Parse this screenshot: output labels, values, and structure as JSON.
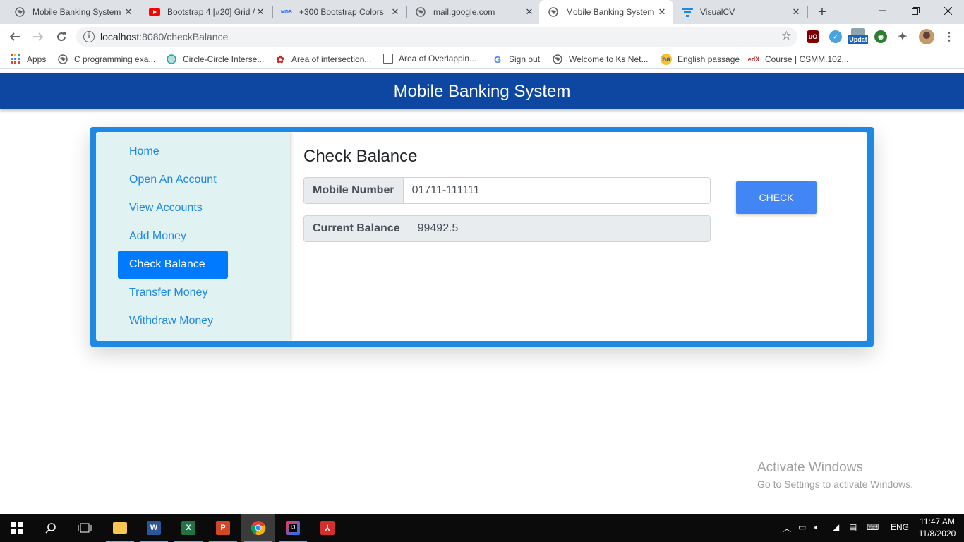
{
  "browser": {
    "tabs": [
      {
        "title": "Mobile Banking System",
        "icon": "globe-icon"
      },
      {
        "title": "Bootstrap 4 [#20] Grid /",
        "icon": "youtube-icon"
      },
      {
        "title": "+300 Bootstrap Colors",
        "icon": "mdb-icon",
        "icon_text": "MDB"
      },
      {
        "title": "mail.google.com",
        "icon": "globe-icon"
      },
      {
        "title": "Mobile Banking System",
        "icon": "globe-icon"
      },
      {
        "title": "VisualCV",
        "icon": "visualcv-icon"
      }
    ],
    "new_tab_symbol": "+",
    "url_host": "localhost",
    "url_path": ":8080/checkBalance",
    "extension_badge": "Updat",
    "bookmarks": [
      {
        "label": "Apps",
        "icon": "apps-grid-icon"
      },
      {
        "label": "C programming exa...",
        "icon": "globe-icon"
      },
      {
        "label": "Circle-Circle Interse...",
        "icon": "globe-icon"
      },
      {
        "label": "Area of intersection...",
        "icon": "gear-icon"
      },
      {
        "label": "Area of Overlappin...",
        "icon": "document-icon"
      },
      {
        "label": "Sign out",
        "icon": "google-icon",
        "icon_text": "G"
      },
      {
        "label": "Welcome to Ks Net...",
        "icon": "globe-icon"
      },
      {
        "label": "English passage",
        "icon": "ba-icon",
        "icon_text": "ba"
      },
      {
        "label": "Course | CSMM.102...",
        "icon": "edx-icon",
        "icon_text": "edX"
      }
    ]
  },
  "app": {
    "title": "Mobile Banking System",
    "nav": [
      {
        "label": "Home",
        "active": false
      },
      {
        "label": "Open An Account",
        "active": false
      },
      {
        "label": "View Accounts",
        "active": false
      },
      {
        "label": "Add Money",
        "active": false
      },
      {
        "label": "Check Balance",
        "active": true
      },
      {
        "label": "Transfer Money",
        "active": false
      },
      {
        "label": "Withdraw Money",
        "active": false
      }
    ],
    "heading": "Check Balance",
    "mobile_label": "Mobile Number",
    "mobile_value": "01711-111111",
    "balance_label": "Current Balance",
    "balance_value": "99492.5",
    "check_button": "CHECK"
  },
  "watermark": {
    "line1": "Activate Windows",
    "line2": "Go to Settings to activate Windows."
  },
  "taskbar": {
    "language": "ENG",
    "time": "11:47 AM",
    "date": "11/8/2020"
  },
  "colors": {
    "app_bar": "#0d47a1",
    "card_border": "#1e88e5",
    "sidebar_bg": "#e0f2f1",
    "active_nav": "#007bff",
    "check_button": "#4285f4"
  }
}
